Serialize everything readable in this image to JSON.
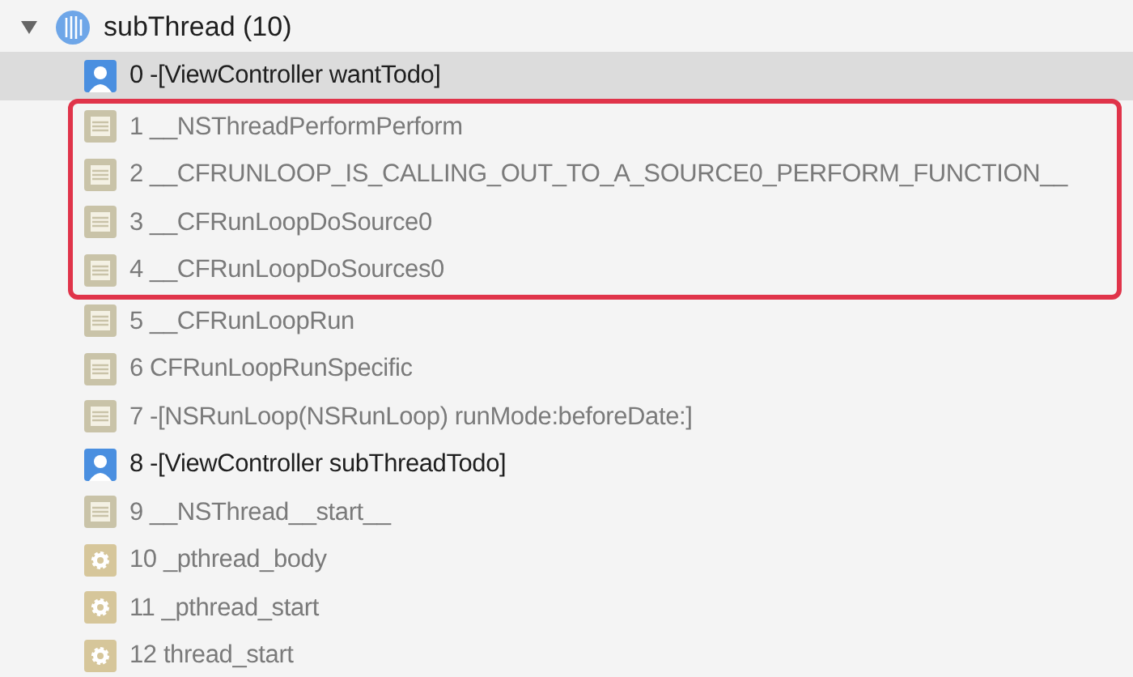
{
  "thread": {
    "title": "subThread (10)",
    "expanded": true,
    "blocks": [
      {
        "highlighted": false,
        "frames": [
          {
            "kind": "user",
            "label": "0 -[ViewController wantTodo]",
            "selected": true
          }
        ]
      },
      {
        "highlighted": true,
        "frames": [
          {
            "kind": "framework",
            "label": "1 __NSThreadPerformPerform",
            "selected": false
          },
          {
            "kind": "framework",
            "label": "2 __CFRUNLOOP_IS_CALLING_OUT_TO_A_SOURCE0_PERFORM_FUNCTION__",
            "selected": false
          },
          {
            "kind": "framework",
            "label": "3 __CFRunLoopDoSource0",
            "selected": false
          },
          {
            "kind": "framework",
            "label": "4 __CFRunLoopDoSources0",
            "selected": false
          }
        ]
      },
      {
        "highlighted": false,
        "frames": [
          {
            "kind": "framework",
            "label": "5 __CFRunLoopRun",
            "selected": false
          },
          {
            "kind": "framework",
            "label": "6 CFRunLoopRunSpecific",
            "selected": false
          },
          {
            "kind": "framework",
            "label": "7 -[NSRunLoop(NSRunLoop) runMode:beforeDate:]",
            "selected": false
          },
          {
            "kind": "user",
            "label": "8 -[ViewController subThreadTodo]",
            "selected": false
          },
          {
            "kind": "framework",
            "label": "9 __NSThread__start__",
            "selected": false
          },
          {
            "kind": "system",
            "label": "10 _pthread_body",
            "selected": false
          },
          {
            "kind": "system",
            "label": "11 _pthread_start",
            "selected": false
          },
          {
            "kind": "system",
            "label": "12 thread_start",
            "selected": false
          }
        ]
      }
    ]
  }
}
